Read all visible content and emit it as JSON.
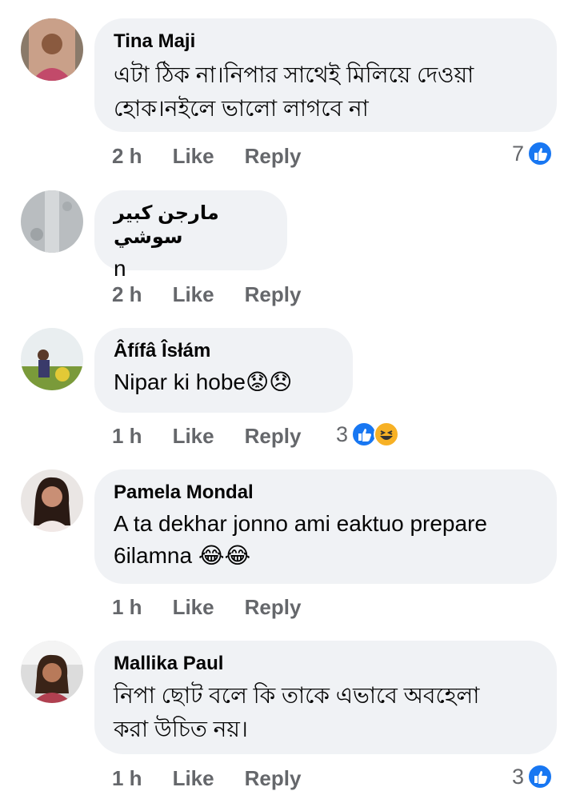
{
  "comments": [
    {
      "author": "Tina Maji",
      "text_lines": [
        "এটা ঠিক না।নিপার সাথেই মিলিয়ে দেওয়া",
        "হোক।নইলে ভালো লাগবে না"
      ],
      "time": "2 h",
      "like": "Like",
      "reply": "Reply",
      "reaction_count": "7",
      "reactions": [
        "like"
      ]
    },
    {
      "author": "مارجن كبير سوشي",
      "text_lines": [
        "n"
      ],
      "time": "2 h",
      "like": "Like",
      "reply": "Reply"
    },
    {
      "author": "Âfífâ Îsłám",
      "text_lines": [
        "Nipar ki hobe😟😞"
      ],
      "time": "1 h",
      "like": "Like",
      "reply": "Reply",
      "reaction_count": "3",
      "reactions": [
        "like",
        "haha"
      ]
    },
    {
      "author": "Pamela Mondal",
      "text_lines": [
        "A ta dekhar jonno ami eaktuo prepare",
        "6ilamna 😂😂"
      ],
      "time": "1 h",
      "like": "Like",
      "reply": "Reply"
    },
    {
      "author": "Mallika Paul",
      "text_lines": [
        "নিপা ছোট বলে কি তাকে এভাবে অবহেলা",
        "করা উচিত নয়।"
      ],
      "time": "1 h",
      "like": "Like",
      "reply": "Reply",
      "reaction_count": "3",
      "reactions": [
        "like"
      ]
    }
  ],
  "colors": {
    "bubble": "#f0f2f5",
    "meta": "#65676b",
    "like_blue": "#1877f2"
  }
}
